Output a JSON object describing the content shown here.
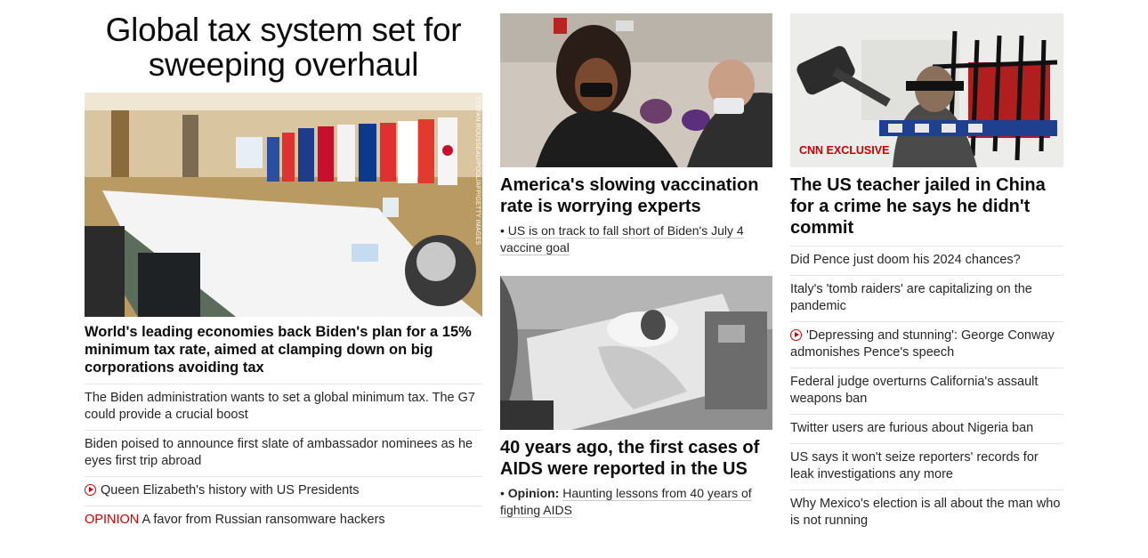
{
  "col1": {
    "title": "Global tax system set for sweeping overhaul",
    "image_credit": "STEFAN ROUSSEAU/POOL/AFP/GETTY IMAGES",
    "headline": "World's leading economies back Biden's plan for a 15% minimum tax rate, aimed at clamping down on big corporations avoiding tax",
    "links": [
      "The Biden administration wants to set a global minimum tax. The G7 could provide a crucial boost",
      "Biden poised to announce first slate of ambassador nominees as he eyes first trip abroad",
      "Queen Elizabeth's history with US Presidents",
      "A favor from Russian ransomware hackers"
    ],
    "opinion_label": "OPINION"
  },
  "col2": {
    "story1": {
      "headline": "America's slowing vaccination rate is worrying experts",
      "sub_prefix": "•",
      "sub": "US is on track to fall short of Biden's July 4 vaccine goal"
    },
    "story2": {
      "headline": "40 years ago, the first cases of AIDS were reported in the US",
      "sub_prefix": "•",
      "sub_label": "Opinion:",
      "sub": "Haunting lessons from 40 years of fighting AIDS"
    }
  },
  "col3": {
    "badge": "CNN EXCLUSIVE",
    "headline": "The US teacher jailed in China for a crime he says he didn't commit",
    "links": [
      "Did Pence just doom his 2024 chances?",
      "Italy's 'tomb raiders' are capitalizing on the pandemic",
      "'Depressing and stunning': George Conway admonishes Pence's speech",
      "Federal judge overturns California's assault weapons ban",
      "Twitter users are furious about Nigeria ban",
      "US says it won't seize reporters' records for leak investigations any more",
      "Why Mexico's election is all about the man who is not running"
    ]
  },
  "colors": {
    "accent": "#cc0000",
    "text": "#0c0c0c",
    "divider": "#e6e6e6"
  },
  "icons": [
    "play-icon"
  ]
}
